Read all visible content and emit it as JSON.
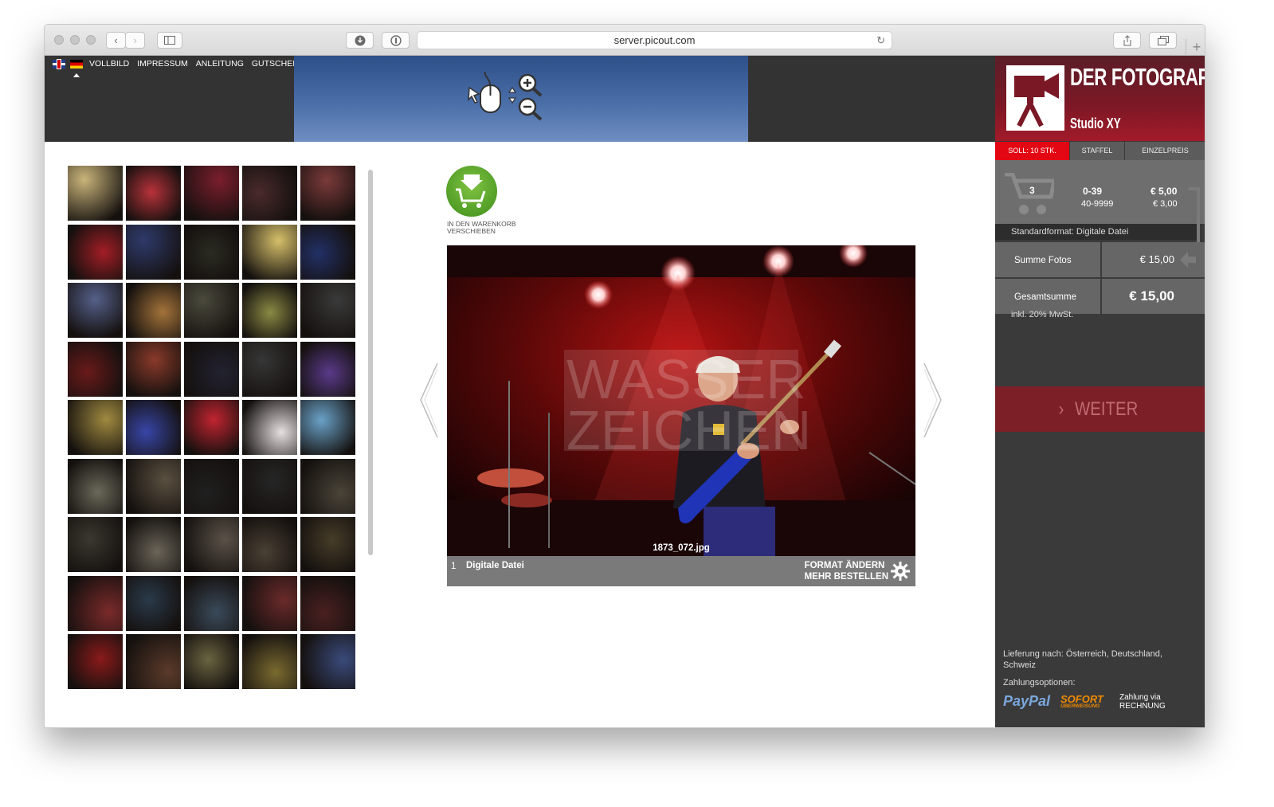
{
  "browser": {
    "url": "server.picout.com"
  },
  "topnav": {
    "links": [
      "VOLLBILD",
      "IMPRESSUM",
      "ANLEITUNG",
      "GUTSCHEIN EI"
    ]
  },
  "thumbnails": [
    "#c9b47a",
    "#b8323a",
    "#7a1e2c",
    "#4a2a2c",
    "#7b3a3a",
    "#a21e26",
    "#2e3a6a",
    "#2b2b22",
    "#d6c06a",
    "#223066",
    "#55608a",
    "#a4733a",
    "#4a4a3c",
    "#8a8a44",
    "#3a3a3a",
    "#6a1a1a",
    "#8a3a2a",
    "#222230",
    "#363636",
    "#5a3a8a",
    "#a08a40",
    "#3846a8",
    "#c02430",
    "#e6e0e0",
    "#6aa2c8",
    "#6a6a5a",
    "#5a5040",
    "#202020",
    "#262626",
    "#4a4438",
    "#3a3830",
    "#6a6458",
    "#5a5248",
    "#4a4034",
    "#463c28",
    "#7a2a2a",
    "#2a3a4a",
    "#3a4a5a",
    "#6a2a2a",
    "#4a2020",
    "#8a1a1a",
    "#5a3a2a",
    "#6a6440",
    "#7a6a30",
    "#3a4a7a"
  ],
  "cart_action": {
    "label": "IN DEN WARENKORB VERSCHIEBEN"
  },
  "viewer": {
    "filename": "1873_072.jpg",
    "watermark": "WASSER ZEICHEN",
    "position": "1",
    "format": "Digitale Datei",
    "action1": "FORMAT ÄNDERN",
    "action2": "MEHR BESTELLEN"
  },
  "sidebar": {
    "brand_title": "DER FOTOGRAF",
    "brand_sub": "Studio XY",
    "tabs": [
      "SOLL: 10 STK.",
      "STAFFEL",
      "EINZELPREIS"
    ],
    "cart_count": "3",
    "tiers": [
      {
        "range": "0-39",
        "price": "€ 5,00"
      },
      {
        "range": "40-9999",
        "price": "€ 3,00"
      }
    ],
    "standard_format": "Standardformat: Digitale Datei",
    "sum_label": "Summe Fotos",
    "sum_value": "€ 15,00",
    "total_label": "Gesamtsumme",
    "total_value": "€ 15,00",
    "vat": "inkl. 20% MwSt.",
    "next": "WEITER",
    "delivery": "Lieferung nach: Österreich, Deutschland, Schweiz",
    "payment_label": "Zahlungsoptionen:",
    "paypal": "PayPal",
    "sofort": "SOFORT",
    "sofort_sub": "ÜBERWEISUNG",
    "invoice": "Zahlung via RECHNUNG"
  }
}
